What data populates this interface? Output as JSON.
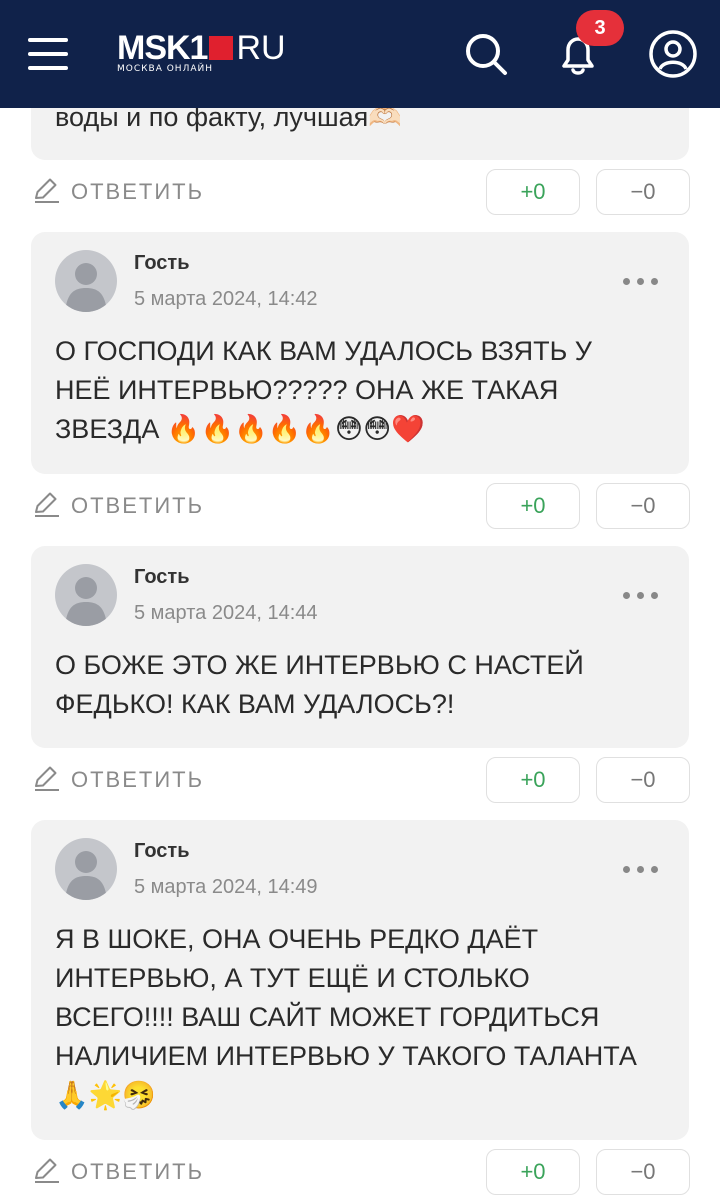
{
  "header": {
    "logo_main": "MSK1",
    "logo_ru": "RU",
    "logo_sub": "МОСКВА ОНЛАЙН",
    "notification_count": "3",
    "colors": {
      "bar": "#10224a",
      "badge": "#e5303a",
      "logo_square": "#e0202e"
    }
  },
  "top_fragment": {
    "text": "воды и по факту, лучшая🫶🏻"
  },
  "actions": {
    "reply_label": "ОТВЕТИТЬ",
    "upvote_label": "+0",
    "downvote_label": "−0"
  },
  "comments": [
    {
      "author": "Гость",
      "date": "5 марта 2024, 14:42",
      "text": "О ГОСПОДИ КАК ВАМ УДАЛОСЬ ВЗЯТЬ У НЕЁ ИНТЕРВЬЮ????? ОНА ЖЕ ТАКАЯ ЗВЕЗДА 🔥🔥🔥🔥🔥😳😳❤️"
    },
    {
      "author": "Гость",
      "date": "5 марта 2024, 14:44",
      "text": "О БОЖЕ ЭТО ЖЕ ИНТЕРВЬЮ С НАСТЕЙ ФЕДЬКО! КАК ВАМ УДАЛОСЬ?!"
    },
    {
      "author": "Гость",
      "date": "5 марта 2024, 14:49",
      "text": "Я В ШОКЕ, ОНА ОЧЕНЬ РЕДКО ДАЁТ ИНТЕРВЬЮ, А ТУТ ЕЩЁ И СТОЛЬКО ВСЕГО!!!! ВАШ САЙТ МОЖЕТ ГОРДИТЬСЯ НАЛИЧИЕМ ИНТЕРВЬЮ У ТАКОГО ТАЛАНТА 🙏🌟🤧"
    }
  ]
}
